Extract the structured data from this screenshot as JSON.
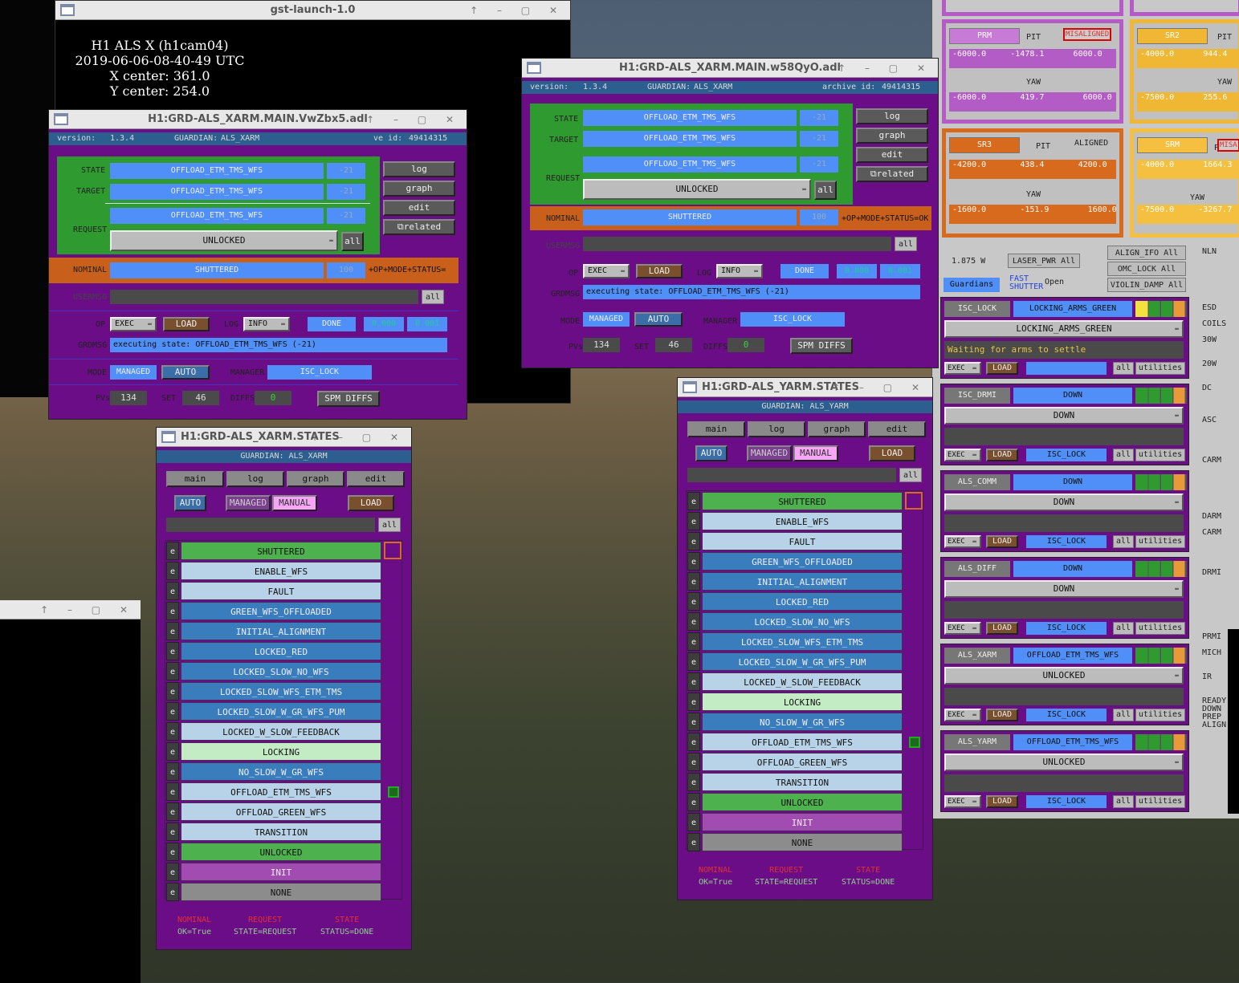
{
  "gst": {
    "title": "gst-launch-1.0",
    "lines": [
      "H1 ALS X (h1cam04)",
      "2019-06-06-08-40-49 UTC",
      "X center: 361.0",
      "Y center: 254.0"
    ]
  },
  "w1": {
    "title": "H1:GRD-ALS_XARM.MAIN.VwZbx5.adl",
    "version_label": "version:",
    "version": "1.3.4",
    "guardian_label": "GUARDIAN:",
    "guardian": "ALS_XARM",
    "archive_label": "ve id:",
    "archive": "49414315",
    "state_label": "STATE",
    "state": "OFFLOAD_ETM_TMS_WFS",
    "state_n": "-21",
    "target_label": "TARGET",
    "target": "OFFLOAD_ETM_TMS_WFS",
    "target_n": "-21",
    "request_label": "REQUEST",
    "request": "OFFLOAD_ETM_TMS_WFS",
    "request_n": "-21",
    "unlocked": "UNLOCKED",
    "all": "all",
    "log": "log",
    "graph": "graph",
    "edit": "edit",
    "related": "related",
    "nominal_label": "NOMINAL",
    "nominal": "SHUTTERED",
    "nominal_n": "100",
    "nominal_flags": "+OP+MODE+STATUS=",
    "usermsg": "USERMSG",
    "op": "OP",
    "exec": "EXEC",
    "load": "LOAD",
    "loglbl": "LOG",
    "info": "INFO",
    "done": "DONE",
    "v1": "0.000",
    "v2": "0.001",
    "grdmsg": "GRDMSG",
    "grdmsg_text": "executing state: OFFLOAD_ETM_TMS_WFS (-21)",
    "mode": "MODE",
    "managed": "MANAGED",
    "auto": "AUTO",
    "manager_label": "MANAGER",
    "manager": "ISC_LOCK",
    "pvs": "PVs",
    "pvs_n": "134",
    "set": "SET",
    "set_n": "46",
    "diffs": "DIFFS",
    "diffs_n": "0",
    "spm": "SPM DIFFS"
  },
  "w2": {
    "title": "H1:GRD-ALS_XARM.MAIN.w58QyO.adl",
    "archive_label": "archive id:",
    "archive": "49414315",
    "nominal_flags": "+OP+MODE+STATUS=OK"
  },
  "w3": {
    "title": "H1:GRD-ALS_XARM.STATES",
    "guardian": "GUARDIAN: ALS_XARM"
  },
  "w4": {
    "title": "H1:GRD-ALS_YARM.STATES",
    "guardian": "GUARDIAN: ALS_YARM"
  },
  "states": {
    "tabs": [
      "main",
      "log",
      "graph",
      "edit"
    ],
    "auto": "AUTO",
    "managed": "MANAGED",
    "manual": "MANUAL",
    "load": "LOAD",
    "all": "all",
    "e": "e",
    "list": [
      {
        "name": "SHUTTERED",
        "c": "st-green"
      },
      {
        "name": "ENABLE_WFS",
        "c": "st-lb"
      },
      {
        "name": "FAULT",
        "c": "st-lb"
      },
      {
        "name": "GREEN_WFS_OFFLOADED",
        "c": "st-db"
      },
      {
        "name": "INITIAL_ALIGNMENT",
        "c": "st-db"
      },
      {
        "name": "LOCKED_RED",
        "c": "st-db"
      },
      {
        "name": "LOCKED_SLOW_NO_WFS",
        "c": "st-db"
      },
      {
        "name": "LOCKED_SLOW_WFS_ETM_TMS",
        "c": "st-db"
      },
      {
        "name": "LOCKED_SLOW_W_GR_WFS_PUM",
        "c": "st-db"
      },
      {
        "name": "LOCKED_W_SLOW_FEEDBACK",
        "c": "st-lb"
      },
      {
        "name": "LOCKING",
        "c": "st-lg"
      },
      {
        "name": "NO_SLOW_W_GR_WFS",
        "c": "st-db"
      },
      {
        "name": "OFFLOAD_ETM_TMS_WFS",
        "c": "st-lb"
      },
      {
        "name": "OFFLOAD_GREEN_WFS",
        "c": "st-lb"
      },
      {
        "name": "TRANSITION",
        "c": "st-lb"
      },
      {
        "name": "UNLOCKED",
        "c": "st-green"
      },
      {
        "name": "INIT",
        "c": "st-pu"
      },
      {
        "name": "NONE",
        "c": "st-gr"
      }
    ],
    "legend": {
      "nominal": "NOMINAL",
      "nominal_v": "OK=True",
      "request": "REQUEST",
      "request_v": "STATE=REQUEST",
      "state": "STATE",
      "state_v": "STATUS=DONE"
    }
  },
  "right": {
    "prm": "PRM",
    "sr2": "SR2",
    "sr3": "SR3",
    "srm": "SRM",
    "pit": "PIT",
    "yaw": "YAW",
    "misaligned": "MISALIGNED",
    "mis": "MISA",
    "aligned": "ALIGNED",
    "prm_p": [
      "-6000.0",
      "-1478.1",
      "6000.0"
    ],
    "prm_y": [
      "-6000.0",
      "419.7",
      "6000.0"
    ],
    "sr2_p": [
      "-4000.0",
      "944.4"
    ],
    "sr2_y": [
      "-7500.0",
      "255.6"
    ],
    "sr3_p": [
      "-4200.0",
      "438.4",
      "4200.0"
    ],
    "sr3_y": [
      "-1600.0",
      "-151.9",
      "1600.0"
    ],
    "srm_p": [
      "-4000.0",
      "1664.3"
    ],
    "srm_y": [
      "-7500.0",
      "-3267.7"
    ],
    "laser": "1.875 W",
    "laser_btn": "LASER_PWR All",
    "align_ifo": "ALIGN_IFO All",
    "omc_lock": "OMC_LOCK All",
    "violin": "VIOLIN_DAMP All",
    "guardians": "Guardians",
    "fast": "FAST",
    "shutter": "SHUTTER",
    "open": "Open",
    "side": [
      "NLN",
      "ESD",
      "COILS",
      "30W",
      "20W",
      "DC",
      "ASC",
      "CARM",
      "DARM",
      "CARM",
      "DRMI",
      "PRMI",
      "MICH",
      "IR",
      "READY",
      "DOWN",
      "PREP",
      "ALIGN"
    ],
    "rows": [
      {
        "name": "ISC_LOCK",
        "state": "LOCKING_ARMS_GREEN",
        "req": "LOCKING_ARMS_GREEN",
        "msg": "Waiting for arms to settle"
      },
      {
        "name": "ISC_DRMI",
        "state": "DOWN",
        "req": "DOWN",
        "mgr": "ISC_LOCK"
      },
      {
        "name": "ALS_COMM",
        "state": "DOWN",
        "req": "DOWN",
        "mgr": "ISC_LOCK"
      },
      {
        "name": "ALS_DIFF",
        "state": "DOWN",
        "req": "DOWN",
        "mgr": "ISC_LOCK"
      },
      {
        "name": "ALS_XARM",
        "state": "OFFLOAD_ETM_TMS_WFS",
        "req": "UNLOCKED",
        "mgr": "ISC_LOCK"
      },
      {
        "name": "ALS_YARM",
        "state": "OFFLOAD_ETM_TMS_WFS",
        "req": "UNLOCKED",
        "mgr": "ISC_LOCK"
      }
    ],
    "exec": "EXEC",
    "load": "LOAD",
    "all": "all",
    "utilities": "utilities"
  }
}
